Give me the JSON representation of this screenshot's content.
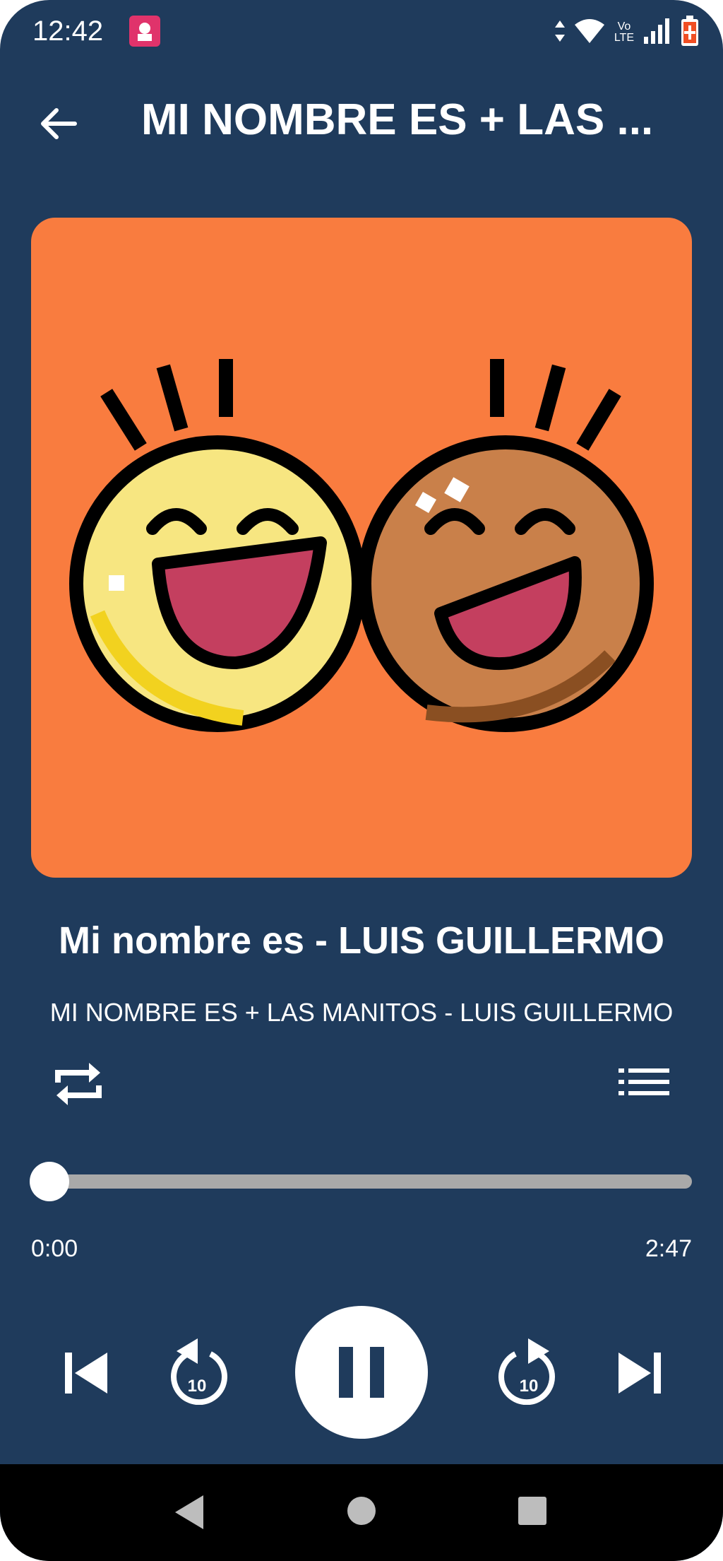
{
  "status_bar": {
    "time": "12:42",
    "network_label_top": "Vo",
    "network_label_bottom": "LTE",
    "icons": [
      "app-notification-icon",
      "data-arrows-icon",
      "wifi-icon",
      "volte-icon",
      "signal-icon",
      "battery-icon"
    ]
  },
  "top_bar": {
    "back_icon": "arrow-left-icon",
    "title": "MI NOMBRE ES + LAS ..."
  },
  "now_playing": {
    "song_title": "Mi nombre es - LUIS GUILLERMO",
    "album_line": "MI NOMBRE ES + LAS MANITOS - LUIS GUILLERMO",
    "artwork_bg": "#f97c3f"
  },
  "player": {
    "current_time": "0:00",
    "total_time": "2:47",
    "progress": 0,
    "repeat_icon": "repeat-icon",
    "queue_icon": "queue-list-icon",
    "rewind_label": "10",
    "forward_label": "10",
    "state": "playing"
  },
  "colors": {
    "background": "#1f3b5c",
    "accent": "#ffffff"
  }
}
